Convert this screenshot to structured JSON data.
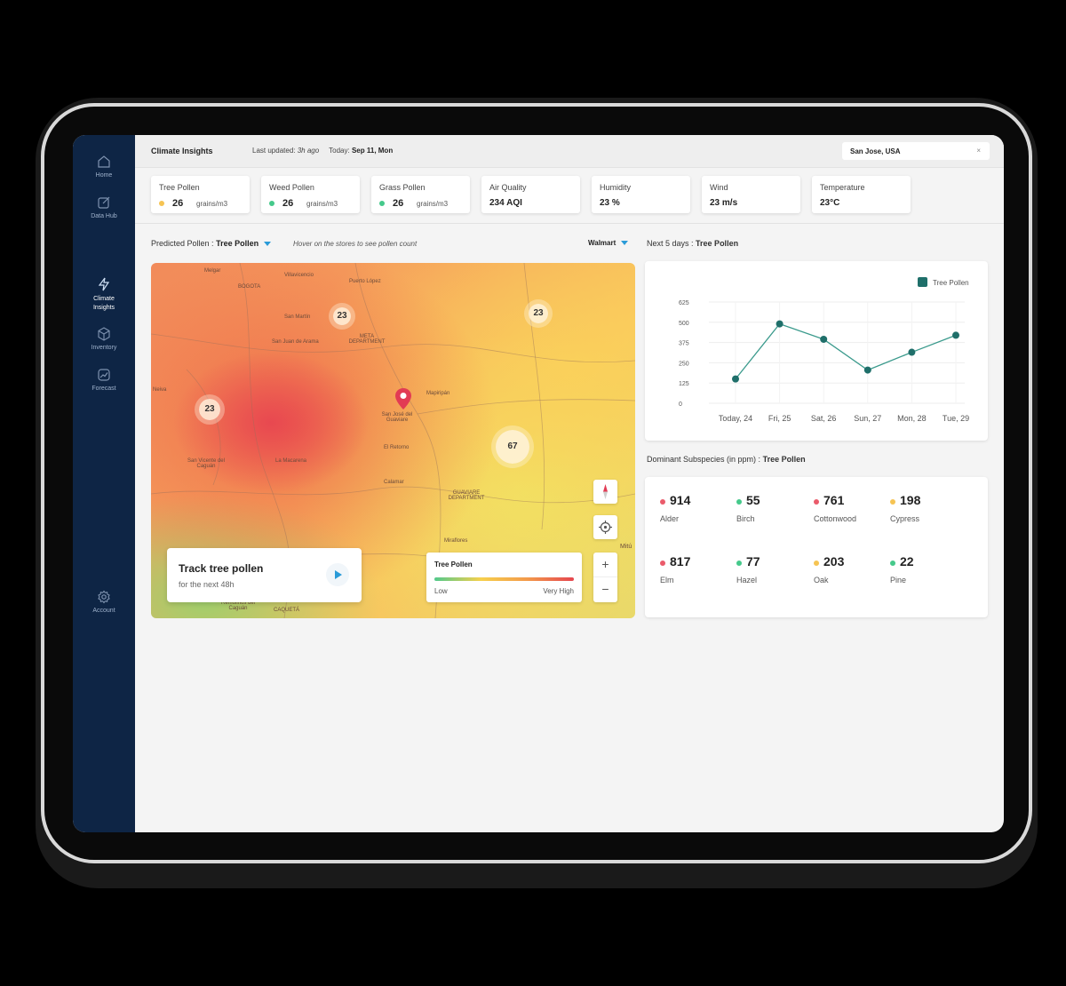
{
  "nav": [
    {
      "label": "Home",
      "icon": "home-icon"
    },
    {
      "label": "Data Hub",
      "icon": "data-hub-icon"
    },
    {
      "label": "Climate Insights",
      "icon": "lightning-icon"
    },
    {
      "label": "Inventory",
      "icon": "box-icon"
    },
    {
      "label": "Forecast",
      "icon": "trend-icon"
    },
    {
      "label": "Account",
      "icon": "gear-icon"
    }
  ],
  "header": {
    "title": "Climate Insights",
    "last_updated_label": "Last updated:",
    "last_updated_value": "3h ago",
    "today_label": "Today:",
    "today_value": "Sep 11, Mon",
    "location": "San Jose, USA",
    "clear": "×"
  },
  "metrics": [
    {
      "label": "Tree Pollen",
      "value": "26",
      "unit": "grains/m3",
      "dot_color": "#f6c453"
    },
    {
      "label": "Weed Pollen",
      "value": "26",
      "unit": "grains/m3",
      "dot_color": "#45c98b"
    },
    {
      "label": "Grass Pollen",
      "value": "26",
      "unit": "grains/m3",
      "dot_color": "#45c98b"
    },
    {
      "label": "Air Quality",
      "value": "234 AQI"
    },
    {
      "label": "Humidity",
      "value": "23 %"
    },
    {
      "label": "Wind",
      "value": "23 m/s"
    },
    {
      "label": "Temperature",
      "value": "23°C"
    }
  ],
  "pollen_selector": {
    "label": "Predicted Pollen :",
    "value": "Tree Pollen",
    "hint": "Hover on the stores to see pollen count",
    "store": "Walmart"
  },
  "map": {
    "clusters": [
      "23",
      "23",
      "23",
      "67"
    ],
    "places": [
      "BOGOTA",
      "Villavicencio",
      "Puerto López",
      "San Martín",
      "San Juan de Arama",
      "META DEPARTMENT",
      "Mapiripán",
      "San José del Guaviare",
      "El Retorno",
      "Calamar",
      "GUAVIARE DEPARTMENT",
      "Miraflores",
      "San Vicente del Caguán",
      "La Macarena",
      "Mitú",
      "CAQUETÁ",
      "Remolinos del Caguán",
      "Neiva",
      "Melgar",
      "META DEPARTMENT"
    ],
    "track": {
      "title": "Track tree pollen",
      "subtitle": "for the next 48h"
    },
    "legend": {
      "title": "Tree Pollen",
      "low": "Low",
      "high": "Very High"
    },
    "zoom_in": "+",
    "zoom_out": "−"
  },
  "forecast": {
    "label": "Next 5 days :",
    "value": "Tree Pollen"
  },
  "chart_data": {
    "type": "line",
    "categories": [
      "Today, 24",
      "Fri, 25",
      "Sat, 26",
      "Sun, 27",
      "Mon, 28",
      "Tue, 29"
    ],
    "series": [
      {
        "name": "Tree Pollen",
        "values": [
          150,
          490,
          395,
          205,
          315,
          420
        ],
        "color": "#1f6f6a"
      }
    ],
    "yticks": [
      0,
      125,
      250,
      375,
      500,
      625
    ],
    "ylim": [
      0,
      625
    ],
    "legend": "top-right",
    "grid": true
  },
  "subspecies": {
    "label": "Dominant Subspecies (in ppm) :",
    "value": "Tree Pollen",
    "items": [
      {
        "name": "Alder",
        "value": "914",
        "color": "#ea5b6b"
      },
      {
        "name": "Birch",
        "value": "55",
        "color": "#45c98b"
      },
      {
        "name": "Cottonwood",
        "value": "761",
        "color": "#ea5b6b"
      },
      {
        "name": "Cypress",
        "value": "198",
        "color": "#f6c453"
      },
      {
        "name": "Elm",
        "value": "817",
        "color": "#ea5b6b"
      },
      {
        "name": "Hazel",
        "value": "77",
        "color": "#45c98b"
      },
      {
        "name": "Oak",
        "value": "203",
        "color": "#f6c453"
      },
      {
        "name": "Pine",
        "value": "22",
        "color": "#45c98b"
      }
    ]
  }
}
